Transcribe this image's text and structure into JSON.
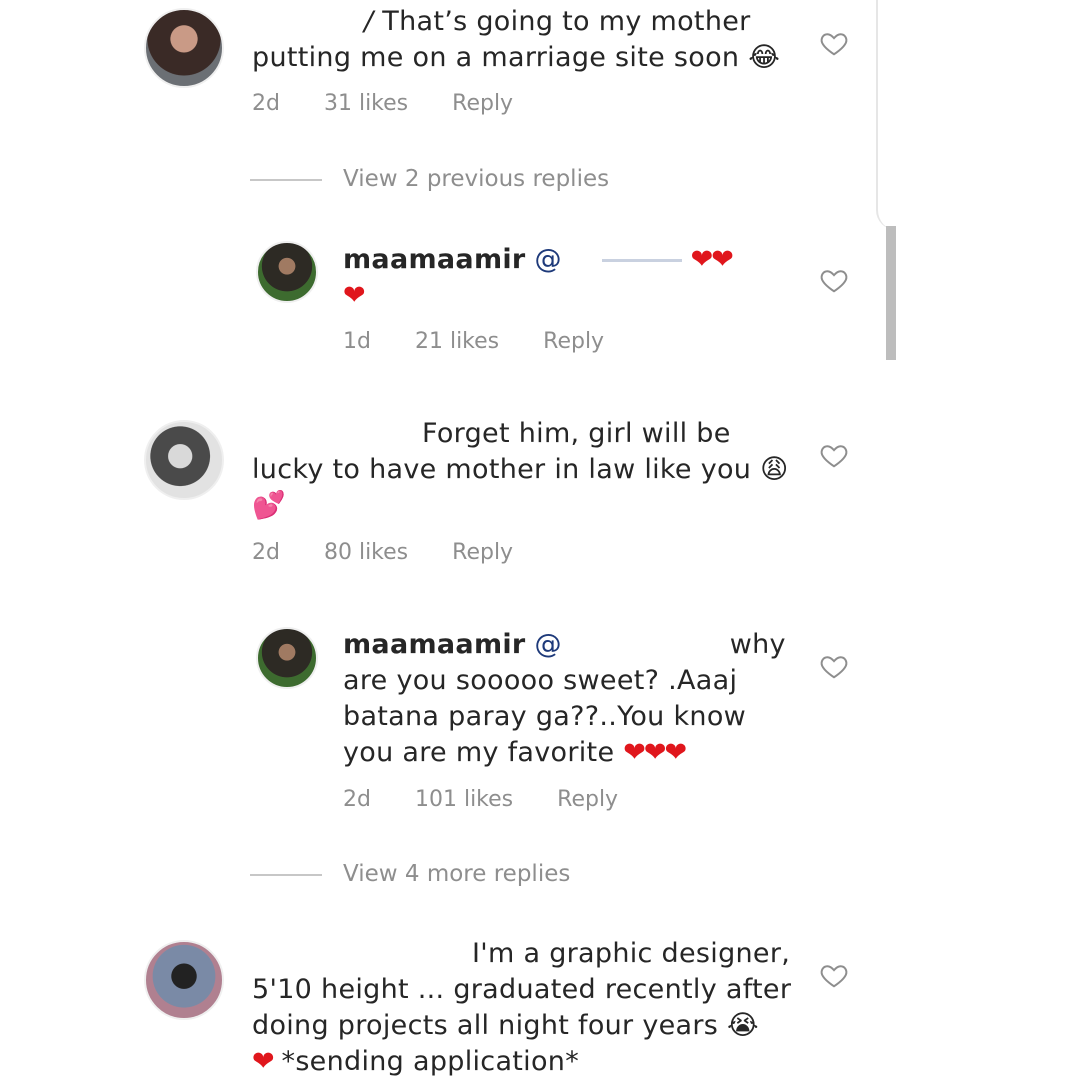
{
  "comments": [
    {
      "text_line1": "That’s going to my mother",
      "text_line2": "putting me on a marriage site soon",
      "emoji": "😂",
      "time": "2d",
      "likes": "31 likes",
      "reply": "Reply"
    },
    {
      "text_line1": "Forget him, girl will be",
      "text_line2": "lucky to have mother in law like you",
      "emoji": "😩",
      "emoji2": "💕",
      "time": "2d",
      "likes": "80 likes",
      "reply": "Reply"
    },
    {
      "text_line1": "I'm a graphic designer,",
      "text_line2": "5'10 height ... graduated recently after",
      "text_line3": "doing projects all night four years",
      "emoji": "😭",
      "text_line4": "*sending application*"
    }
  ],
  "view_previous": "View 2 previous replies",
  "view_more": "View 4 more replies",
  "replies": [
    {
      "username": "maamaamir",
      "mention": "@",
      "hearts": "❤❤",
      "hearts2": "❤",
      "time": "1d",
      "likes": "21 likes",
      "reply": "Reply"
    },
    {
      "username": "maamaamir",
      "mention": "@",
      "text_line1_end": "why",
      "text_line2": "are you sooooo sweet? .Aaaj",
      "text_line3": "batana paray ga??..You know",
      "text_line4": "you are my favorite",
      "hearts": "❤❤❤",
      "time": "2d",
      "likes": "101 likes",
      "reply": "Reply"
    }
  ],
  "colors": {
    "heart_red": "#e0161c",
    "meta_gray": "#8e8e8e",
    "mention_blue": "#1e3a7a"
  }
}
